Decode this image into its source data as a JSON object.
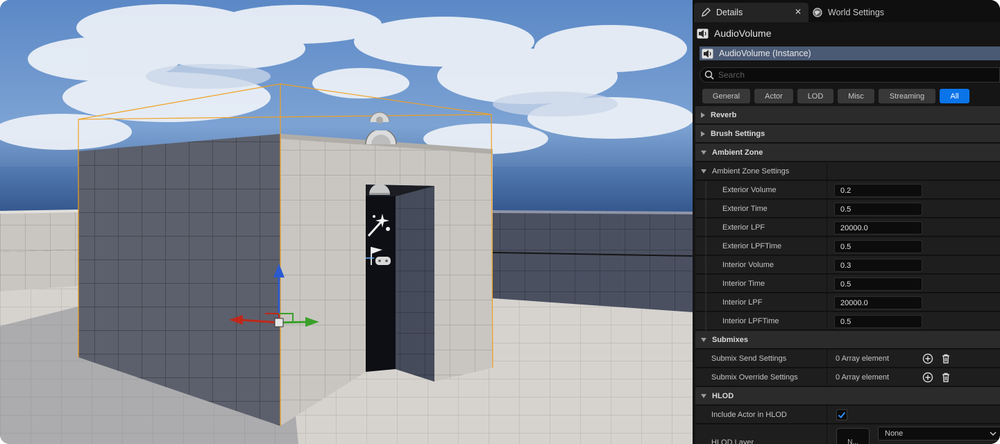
{
  "tabs": [
    {
      "label": "Details",
      "icon": "pencil-icon"
    },
    {
      "label": "World Settings",
      "icon": "globe-icon"
    }
  ],
  "actor": {
    "name": "AudioVolume",
    "icon": "speaker-icon"
  },
  "instance": {
    "label": "AudioVolume (Instance)"
  },
  "search": {
    "placeholder": "Search"
  },
  "filters": [
    {
      "label": "General"
    },
    {
      "label": "Actor"
    },
    {
      "label": "LOD"
    },
    {
      "label": "Misc"
    },
    {
      "label": "Streaming"
    },
    {
      "label": "All",
      "active": true
    }
  ],
  "categories": {
    "reverb": "Reverb",
    "brush": "Brush Settings",
    "ambient": "Ambient Zone",
    "ambient_settings": "Ambient Zone Settings",
    "submixes": "Submixes",
    "hlod": "HLOD"
  },
  "ambient_props": [
    {
      "label": "Exterior Volume",
      "value": "0.2"
    },
    {
      "label": "Exterior Time",
      "value": "0.5"
    },
    {
      "label": "Exterior LPF",
      "value": "20000.0"
    },
    {
      "label": "Exterior LPFTime",
      "value": "0.5"
    },
    {
      "label": "Interior Volume",
      "value": "0.3"
    },
    {
      "label": "Interior Time",
      "value": "0.5"
    },
    {
      "label": "Interior LPF",
      "value": "20000.0"
    },
    {
      "label": "Interior LPFTime",
      "value": "0.5"
    }
  ],
  "submix_props": [
    {
      "label": "Submix Send Settings",
      "value": "0 Array element"
    },
    {
      "label": "Submix Override Settings",
      "value": "0 Array element"
    }
  ],
  "hlod": {
    "include_label": "Include Actor in HLOD",
    "include_checked": true,
    "layer_label": "HLOD Layer",
    "layer_thumb": "N...",
    "layer_value": "None"
  },
  "colors": {
    "accent": "#0a74e8",
    "selection": "#4a5a75",
    "bounds": "#f0a020",
    "gizmo_x": "#c0281a",
    "gizmo_y": "#3aa02a",
    "gizmo_z": "#2a5ad0"
  },
  "viewport_icons": [
    "audio-volume-billboard-icon",
    "speaker-billboard-icon",
    "light-billboard-icon",
    "sparkle-wand-icon",
    "player-start-flag-icon"
  ]
}
